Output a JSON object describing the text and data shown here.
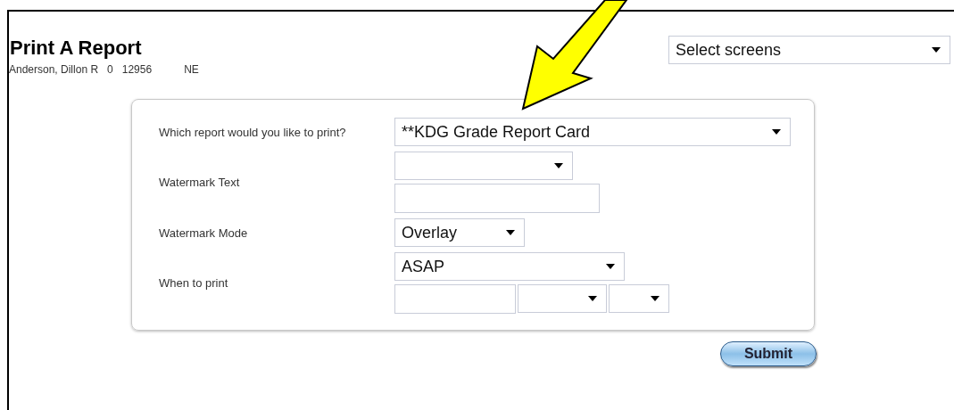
{
  "page": {
    "title": "Print A Report",
    "student": [
      "Anderson, Dillon R",
      "0",
      "12956",
      "NE"
    ]
  },
  "screen_select": {
    "value": "Select screens"
  },
  "form": {
    "rows": [
      {
        "label": "Which report would you like to print?",
        "controls": [
          [
            {
              "kind": "select",
              "value": "**KDG Grade Report Card"
            }
          ]
        ]
      },
      {
        "label": "Watermark Text",
        "controls": [
          [
            {
              "kind": "select"
            }
          ],
          [
            {
              "kind": "input"
            }
          ]
        ]
      },
      {
        "label": "Watermark Mode",
        "controls": [
          [
            {
              "kind": "select",
              "value": "Overlay"
            }
          ]
        ]
      },
      {
        "label": "When to print",
        "controls": [
          [
            {
              "kind": "select",
              "value": "ASAP"
            }
          ],
          [
            {
              "kind": "input"
            },
            {
              "kind": "select"
            },
            {
              "kind": "select"
            }
          ]
        ]
      }
    ]
  },
  "submit": "Submit",
  "annotation": {
    "kind": "arrow"
  }
}
